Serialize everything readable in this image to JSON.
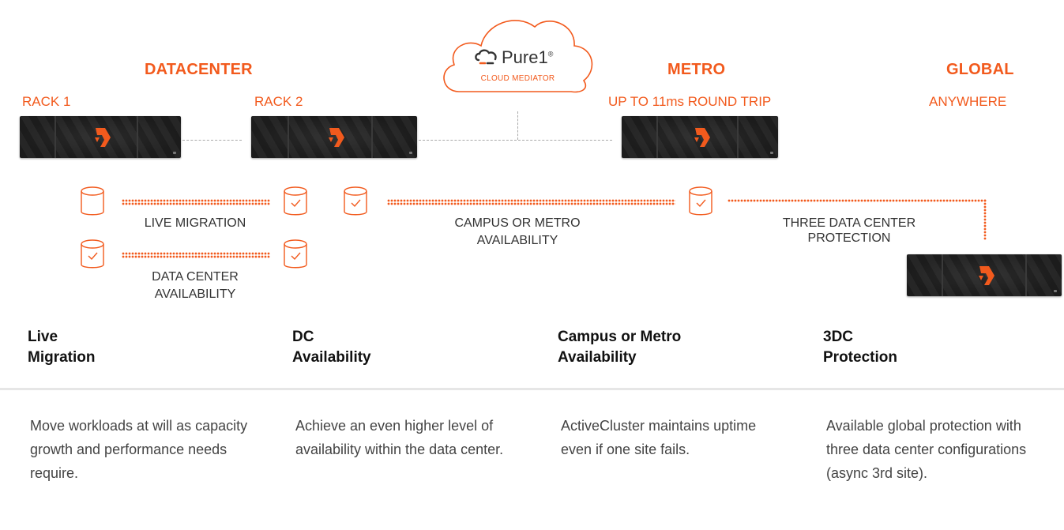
{
  "colors": {
    "accent": "#f25a1d",
    "divider": "#e6e6e6"
  },
  "header": {
    "datacenter": "DATACENTER",
    "rack1": "RACK 1",
    "rack2": "RACK 2",
    "metro": "METRO",
    "metro_sub": "UP TO 11ms ROUND TRIP",
    "global": "GLOBAL",
    "global_sub": "ANYWHERE"
  },
  "cloud": {
    "brand": "Pure1",
    "mark": "®",
    "caption": "CLOUD MEDIATOR"
  },
  "links": {
    "live_migration": "LIVE MIGRATION",
    "dc_availability_1": "DATA CENTER",
    "dc_availability_2": "AVAILABILITY",
    "campus_1": "CAMPUS OR METRO",
    "campus_2": "AVAILABILITY",
    "three_dc_1": "THREE DATA CENTER",
    "three_dc_2": "PROTECTION"
  },
  "features": [
    {
      "line1": "Live",
      "line2": "Migration",
      "desc": "Move workloads at will as capacity growth and performance needs require."
    },
    {
      "line1": "DC",
      "line2": "Availability",
      "desc": "Achieve an even higher level of availability within the data center."
    },
    {
      "line1": "Campus or Metro",
      "line2": "Availability",
      "desc": "ActiveCluster maintains uptime even if one site fails."
    },
    {
      "line1": "3DC",
      "line2": "Protection",
      "desc": "Available global protection with three data center configurations (async 3rd site)."
    }
  ]
}
